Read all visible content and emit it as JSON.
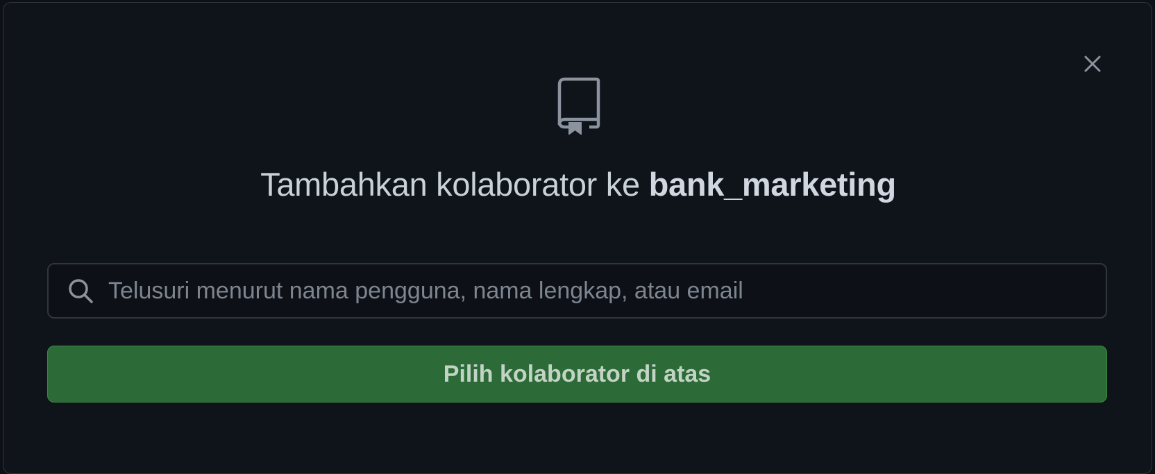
{
  "dialog": {
    "close_label": "Close",
    "icon": "repo-icon",
    "title": {
      "prefix": "Tambahkan kolaborator ke ",
      "repo_name": "bank_marketing"
    },
    "search": {
      "icon": "search-icon",
      "value": "",
      "placeholder": "Telusuri menurut nama pengguna, nama lengkap, atau email"
    },
    "primary_button_label": "Pilih kolaborator di atas"
  },
  "colors": {
    "background": "#0d1117",
    "border": "#30363d",
    "text": "#c9d1d9",
    "muted": "#7d8590",
    "button_green": "#2c6b37"
  }
}
